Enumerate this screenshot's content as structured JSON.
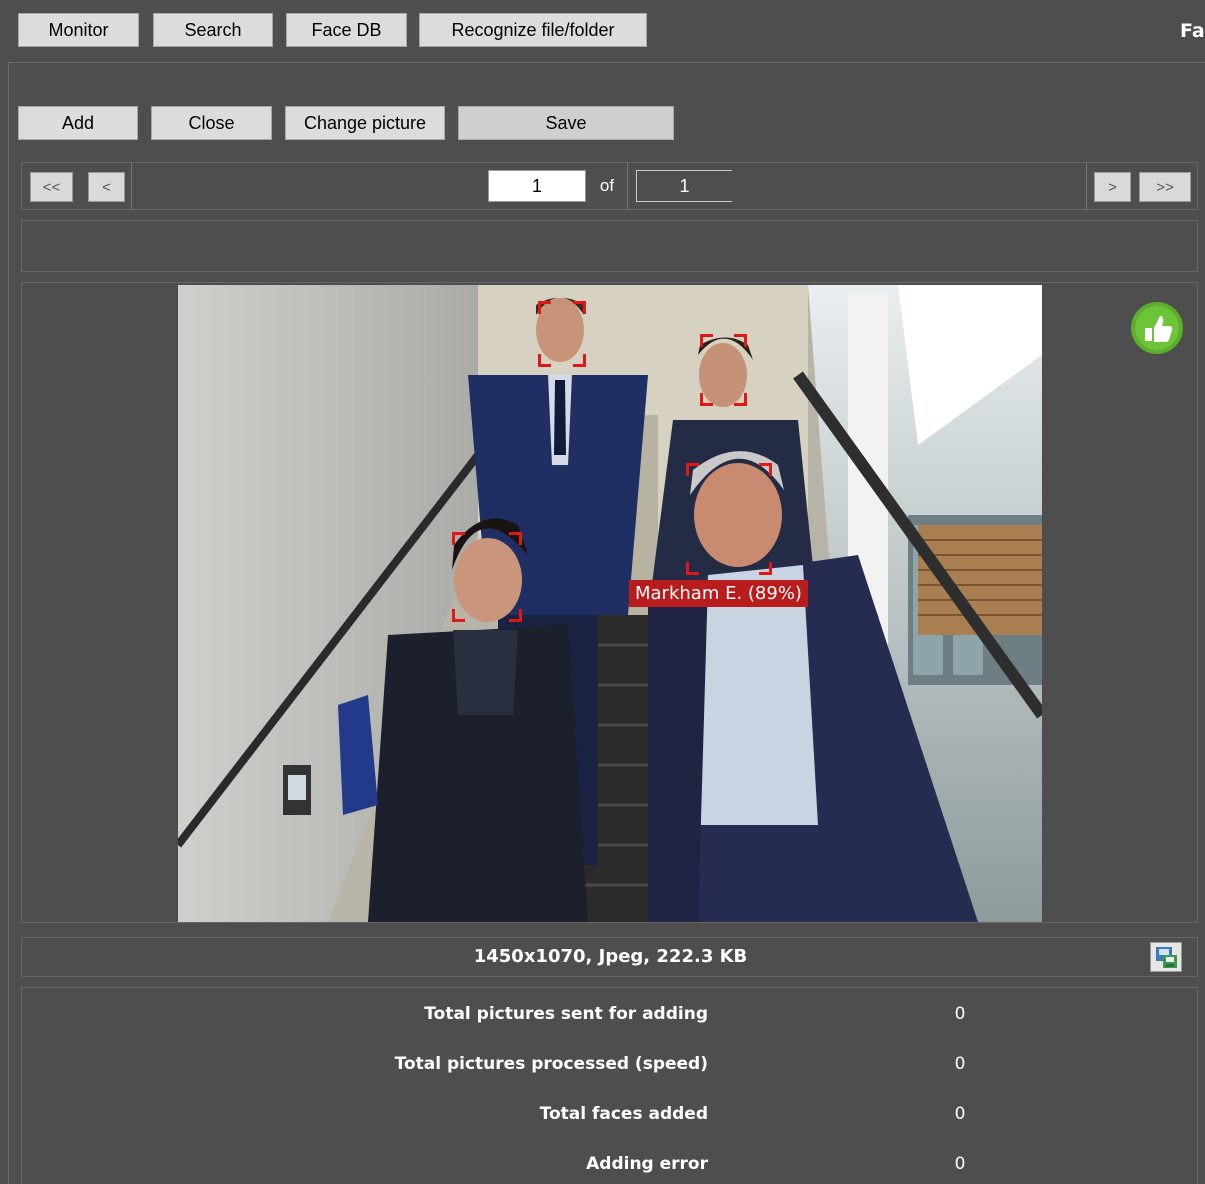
{
  "toolbar": {
    "monitor": "Monitor",
    "search": "Search",
    "face_db": "Face DB",
    "recognize": "Recognize file/folder",
    "brand_fragment": "Fa"
  },
  "actions": {
    "add": "Add",
    "close": "Close",
    "change_picture": "Change picture",
    "save": "Save"
  },
  "pager": {
    "first": "<<",
    "prev": "<",
    "current": "1",
    "of": "of",
    "total": "1",
    "next": ">",
    "last": ">>"
  },
  "viewer": {
    "recognition_label": "Markham E. (89%)",
    "approve_icon": "thumbs-up-icon",
    "file_info": "1450x1070, Jpeg, 222.3 KB",
    "save_image_icon": "save-image-icon"
  },
  "stats": [
    {
      "label": "Total pictures sent for adding",
      "value": "0"
    },
    {
      "label": "Total pictures processed (speed)",
      "value": "0"
    },
    {
      "label": "Total faces added",
      "value": "0"
    },
    {
      "label": "Adding error",
      "value": "0"
    }
  ],
  "colors": {
    "background": "#4e4e4e",
    "button": "#dcdcdc",
    "face_box": "#e01818",
    "approve_icon": "#5cae2c"
  }
}
